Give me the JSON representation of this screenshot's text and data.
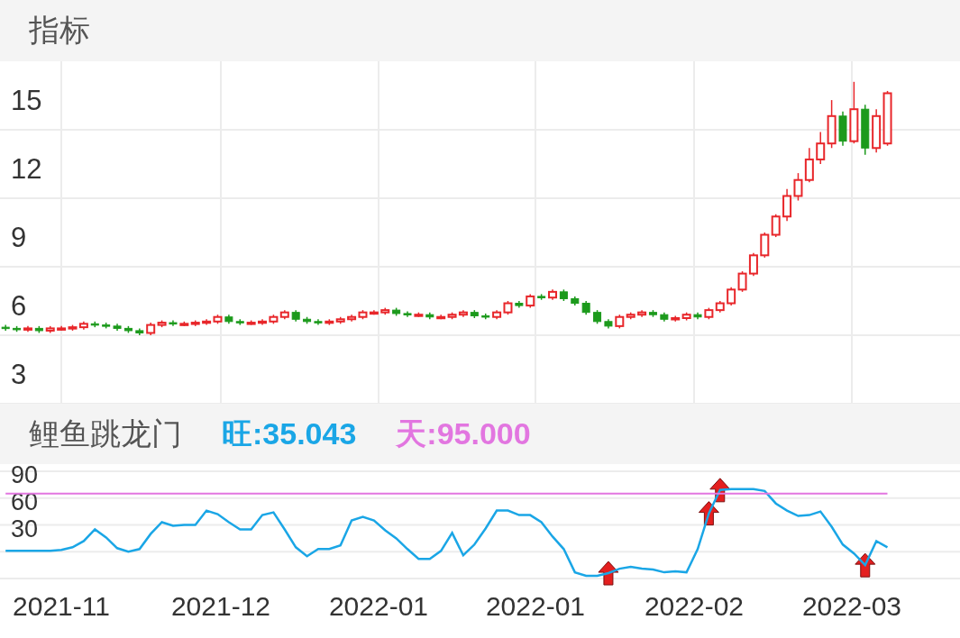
{
  "main_panel": {
    "title": "指标",
    "chart_data": {
      "type": "candlestick",
      "grid": true,
      "ylim": [
        3,
        18
      ],
      "yticks": [
        3,
        6,
        9,
        12,
        15
      ],
      "ohlc": [
        [
          6.35,
          6.45,
          6.2,
          6.3
        ],
        [
          6.3,
          6.4,
          6.15,
          6.25
        ],
        [
          6.25,
          6.4,
          6.15,
          6.3
        ],
        [
          6.3,
          6.4,
          6.1,
          6.2
        ],
        [
          6.2,
          6.4,
          6.1,
          6.3
        ],
        [
          6.3,
          6.4,
          6.2,
          6.3
        ],
        [
          6.3,
          6.45,
          6.2,
          6.35
        ],
        [
          6.35,
          6.6,
          6.25,
          6.5
        ],
        [
          6.5,
          6.6,
          6.35,
          6.45
        ],
        [
          6.45,
          6.55,
          6.3,
          6.4
        ],
        [
          6.4,
          6.5,
          6.2,
          6.3
        ],
        [
          6.3,
          6.4,
          6.1,
          6.2
        ],
        [
          6.2,
          6.3,
          6.0,
          6.1
        ],
        [
          6.1,
          6.55,
          6.0,
          6.45
        ],
        [
          6.45,
          6.65,
          6.35,
          6.55
        ],
        [
          6.55,
          6.65,
          6.4,
          6.5
        ],
        [
          6.5,
          6.6,
          6.4,
          6.5
        ],
        [
          6.5,
          6.65,
          6.4,
          6.55
        ],
        [
          6.55,
          6.7,
          6.45,
          6.6
        ],
        [
          6.6,
          6.9,
          6.5,
          6.8
        ],
        [
          6.8,
          6.9,
          6.5,
          6.6
        ],
        [
          6.6,
          6.7,
          6.45,
          6.55
        ],
        [
          6.55,
          6.65,
          6.45,
          6.55
        ],
        [
          6.55,
          6.7,
          6.45,
          6.6
        ],
        [
          6.6,
          6.9,
          6.5,
          6.8
        ],
        [
          6.8,
          7.1,
          6.7,
          7.0
        ],
        [
          7.0,
          7.1,
          6.6,
          6.7
        ],
        [
          6.7,
          6.8,
          6.5,
          6.6
        ],
        [
          6.6,
          6.7,
          6.45,
          6.55
        ],
        [
          6.55,
          6.7,
          6.45,
          6.6
        ],
        [
          6.6,
          6.8,
          6.5,
          6.7
        ],
        [
          6.7,
          6.9,
          6.6,
          6.8
        ],
        [
          6.8,
          7.1,
          6.7,
          7.0
        ],
        [
          7.0,
          7.1,
          6.9,
          7.0
        ],
        [
          7.0,
          7.2,
          6.9,
          7.1
        ],
        [
          7.1,
          7.2,
          6.85,
          6.95
        ],
        [
          6.95,
          7.05,
          6.8,
          6.9
        ],
        [
          6.9,
          7.0,
          6.8,
          6.9
        ],
        [
          6.9,
          7.0,
          6.7,
          6.8
        ],
        [
          6.8,
          6.9,
          6.7,
          6.8
        ],
        [
          6.8,
          7.0,
          6.7,
          6.9
        ],
        [
          6.9,
          7.1,
          6.8,
          7.0
        ],
        [
          7.0,
          7.1,
          6.75,
          6.85
        ],
        [
          6.85,
          6.95,
          6.7,
          6.8
        ],
        [
          6.8,
          7.1,
          6.7,
          7.0
        ],
        [
          7.0,
          7.5,
          6.9,
          7.4
        ],
        [
          7.4,
          7.5,
          7.2,
          7.3
        ],
        [
          7.3,
          7.8,
          7.2,
          7.7
        ],
        [
          7.7,
          7.8,
          7.55,
          7.65
        ],
        [
          7.65,
          8.0,
          7.55,
          7.9
        ],
        [
          7.9,
          8.0,
          7.5,
          7.6
        ],
        [
          7.6,
          7.7,
          7.3,
          7.4
        ],
        [
          7.4,
          7.5,
          6.9,
          7.0
        ],
        [
          7.0,
          7.1,
          6.5,
          6.6
        ],
        [
          6.6,
          6.7,
          6.3,
          6.4
        ],
        [
          6.4,
          6.9,
          6.3,
          6.8
        ],
        [
          6.8,
          7.0,
          6.7,
          6.9
        ],
        [
          6.9,
          7.1,
          6.8,
          7.0
        ],
        [
          7.0,
          7.1,
          6.8,
          6.9
        ],
        [
          6.9,
          7.0,
          6.6,
          6.7
        ],
        [
          6.7,
          6.85,
          6.6,
          6.75
        ],
        [
          6.75,
          7.0,
          6.65,
          6.9
        ],
        [
          6.9,
          7.0,
          6.7,
          6.8
        ],
        [
          6.8,
          7.2,
          6.7,
          7.1
        ],
        [
          7.1,
          7.5,
          7.0,
          7.4
        ],
        [
          7.4,
          8.1,
          7.3,
          8.0
        ],
        [
          8.0,
          8.8,
          7.9,
          8.7
        ],
        [
          8.7,
          9.6,
          8.6,
          9.5
        ],
        [
          9.5,
          10.5,
          9.4,
          10.4
        ],
        [
          10.4,
          11.3,
          10.3,
          11.2
        ],
        [
          11.2,
          12.4,
          11.0,
          12.1
        ],
        [
          12.1,
          13.1,
          11.9,
          12.8
        ],
        [
          12.8,
          14.2,
          12.7,
          13.7
        ],
        [
          13.7,
          14.9,
          13.5,
          14.4
        ],
        [
          14.4,
          16.3,
          14.2,
          15.6
        ],
        [
          15.6,
          15.8,
          14.3,
          14.5
        ],
        [
          14.5,
          17.1,
          14.4,
          15.9
        ],
        [
          15.9,
          16.1,
          13.9,
          14.2
        ],
        [
          14.2,
          15.9,
          14.0,
          15.6
        ],
        [
          14.4,
          16.7,
          14.3,
          16.6
        ]
      ]
    }
  },
  "indicator_panel": {
    "title": "鲤鱼跳龙门",
    "readings": [
      {
        "text": "旺:35.043",
        "color": "#1aa6e6"
      },
      {
        "text": "天:95.000",
        "color": "#e276e0"
      }
    ],
    "chart_data": {
      "type": "line",
      "ylim": [
        -30,
        90
      ],
      "yticks": [
        30,
        60,
        90
      ],
      "grid": true,
      "series": [
        {
          "color": "#1aa6e6",
          "values": [
            1,
            1,
            1,
            1,
            1,
            2,
            5,
            12,
            25,
            16,
            4,
            0,
            3,
            20,
            33,
            29,
            30,
            30,
            46,
            42,
            33,
            25,
            25,
            41,
            44,
            25,
            5,
            -5,
            3,
            3,
            7,
            35,
            39,
            35,
            24,
            15,
            3,
            -8,
            -8,
            1,
            21,
            -4,
            8,
            26,
            46,
            46,
            41,
            41,
            33,
            17,
            3,
            -23,
            -27,
            -27,
            -24,
            -19,
            -17,
            -19,
            -20,
            -23,
            -22,
            -23,
            3,
            43,
            69,
            70,
            70,
            70,
            68,
            54,
            46,
            40,
            41,
            45,
            28,
            8,
            -2,
            -15,
            12,
            5
          ]
        },
        {
          "color": "#e276e0",
          "values": [
            65,
            65,
            65,
            65,
            65,
            65,
            65,
            65,
            65,
            65,
            65,
            65,
            65,
            65,
            65,
            65,
            65,
            65,
            65,
            65,
            65,
            65,
            65,
            65,
            65,
            65,
            65,
            65,
            65,
            65,
            65,
            65,
            65,
            65,
            65,
            65,
            65,
            65,
            65,
            65,
            65,
            65,
            65,
            65,
            65,
            65,
            65,
            65,
            65,
            65,
            65,
            65,
            65,
            65,
            65,
            65,
            65,
            65,
            65,
            65,
            65,
            65,
            65,
            65,
            65,
            65,
            65,
            65,
            65,
            65,
            65,
            65,
            65,
            65,
            65,
            65,
            65,
            65,
            65,
            65
          ]
        }
      ]
    },
    "x_labels": [
      "2021-11",
      "2021-12",
      "2022-01",
      "2022-01",
      "2022-02",
      "2022-03"
    ]
  }
}
